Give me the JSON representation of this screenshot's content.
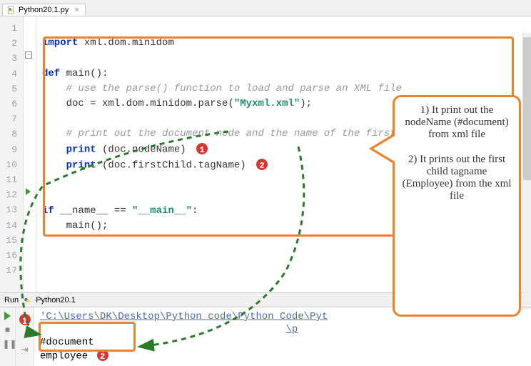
{
  "tab": {
    "filename": "Python20.1.py"
  },
  "gutter_lines": [
    "1",
    "2",
    "3",
    "4",
    "5",
    "6",
    "7",
    "8",
    "9",
    "10",
    "11",
    "12",
    "13",
    "14",
    "15",
    "16",
    "17"
  ],
  "code": {
    "l1_kw": "import",
    "l1_mod": " xml.dom.minidom",
    "l3_kw": "def",
    "l3_name": " main():",
    "l4_cmt": "# use the parse() function to load and parse an XML file",
    "l5_a": "doc = xml.dom.minidom.parse(",
    "l5_str": "\"Myxml.xml\"",
    "l5_b": ");",
    "l7_cmt": "# print out the document node and the name of the first child tag",
    "l8_a": "print",
    "l8_b": " (doc.nodeName)",
    "l9_a": "print",
    "l9_b": " (doc.firstChild.tagName)",
    "l12_kw": "if",
    "l12_a": " __name__ == ",
    "l12_str": "\"__main__\"",
    "l12_b": ":",
    "l13": "main();"
  },
  "badges": {
    "b1": "1",
    "b2": "2"
  },
  "callout": {
    "p1": "1) It print out the nodeName (#document) from xml file",
    "p2": "2) It prints out the first child tagname (Employee) from the xml file"
  },
  "run": {
    "label": "Run",
    "config": "Python20.1",
    "path": "'C:\\Users\\DK\\Desktop\\Python code\\Python Code\\Pyt",
    "path_tail": "\\p",
    "out1": "#document",
    "out2": "employee"
  }
}
